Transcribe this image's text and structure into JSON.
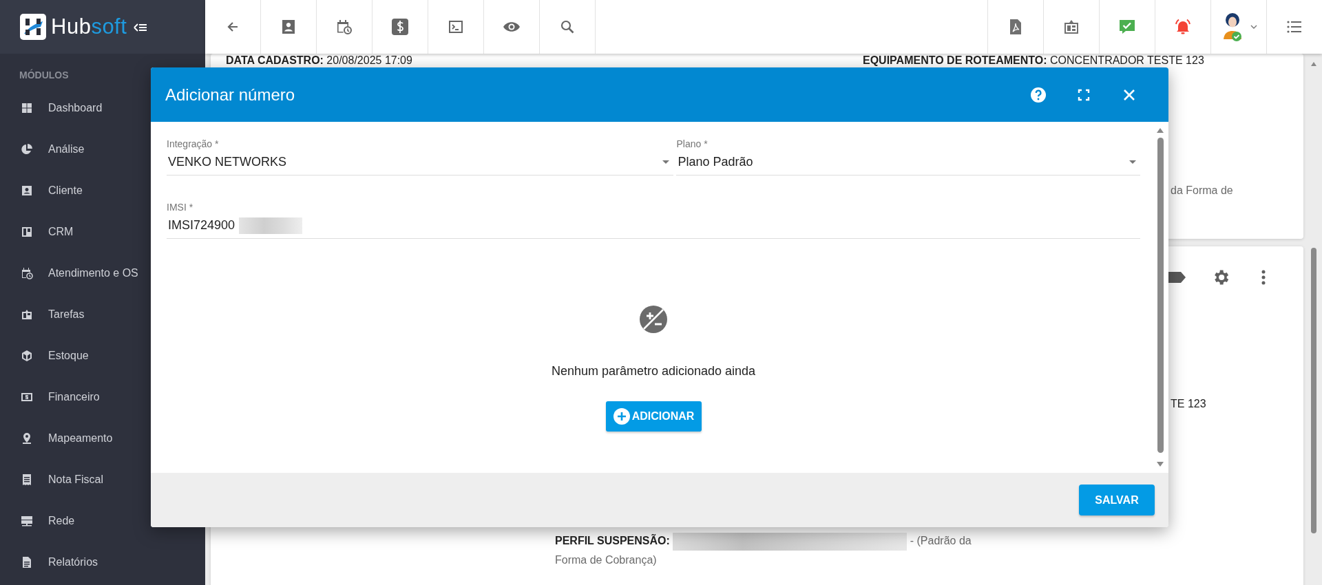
{
  "sidebar": {
    "logo": {
      "part_1": "Hub",
      "part_2": "soft"
    },
    "section_title": "MÓDULOS",
    "items": [
      {
        "label": "Dashboard",
        "kind": "dashboard"
      },
      {
        "label": "Análise",
        "kind": "analysis"
      },
      {
        "label": "Cliente",
        "kind": "client"
      },
      {
        "label": "CRM",
        "kind": "crm"
      },
      {
        "label": "Atendimento e OS",
        "kind": "service"
      },
      {
        "label": "Tarefas",
        "kind": "tasks"
      },
      {
        "label": "Estoque",
        "kind": "stock"
      },
      {
        "label": "Financeiro",
        "kind": "finance"
      },
      {
        "label": "Mapeamento",
        "kind": "map"
      },
      {
        "label": "Nota Fiscal",
        "kind": "invoice"
      },
      {
        "label": "Rede",
        "kind": "network"
      },
      {
        "label": "Relatórios",
        "kind": "reports"
      }
    ]
  },
  "toolbar": {
    "left": [
      {
        "kind": "back"
      },
      {
        "kind": "client"
      },
      {
        "kind": "service"
      },
      {
        "kind": "money"
      },
      {
        "kind": "terminal"
      },
      {
        "kind": "view"
      },
      {
        "kind": "search"
      }
    ],
    "right": [
      {
        "kind": "pdf"
      },
      {
        "kind": "tasks"
      },
      {
        "kind": "chat"
      },
      {
        "kind": "bell"
      },
      {
        "kind": "avatar"
      },
      {
        "kind": "menu"
      }
    ]
  },
  "record": {
    "card_1": {
      "left": {
        "label": "DATA CADASTRO:",
        "value": "20/08/2025 17:09"
      },
      "right": {
        "label": "EQUIPAMENTO DE ROTEAMENTO:",
        "value": "CONCENTRADOR TESTE 123"
      },
      "fragment": "da Forma de"
    },
    "card_2": {
      "fragment": "TE 123",
      "perfil": {
        "label": "PERFIL SUSPENSÃO:",
        "redacted": true,
        "suffix": "- (Padrão da Forma de Cobrança)"
      }
    }
  },
  "modal": {
    "title": "Adicionar número",
    "actions": [
      {
        "kind": "help"
      },
      {
        "kind": "fullscreen"
      },
      {
        "kind": "close"
      }
    ],
    "rows": [
      [
        {
          "kind": "select",
          "label": "Integração *",
          "value": "VENKO NETWORKS"
        },
        {
          "kind": "select",
          "label": "Plano *",
          "value": "Plano Padrão"
        }
      ],
      [
        {
          "kind": "text",
          "label": "IMSI *",
          "value": "IMSI724900",
          "redacted": true
        }
      ]
    ],
    "empty_state": {
      "message": "Nenhum parâmetro adicionado ainda",
      "button": "ADICIONAR"
    },
    "footer_button": "SALVAR"
  }
}
